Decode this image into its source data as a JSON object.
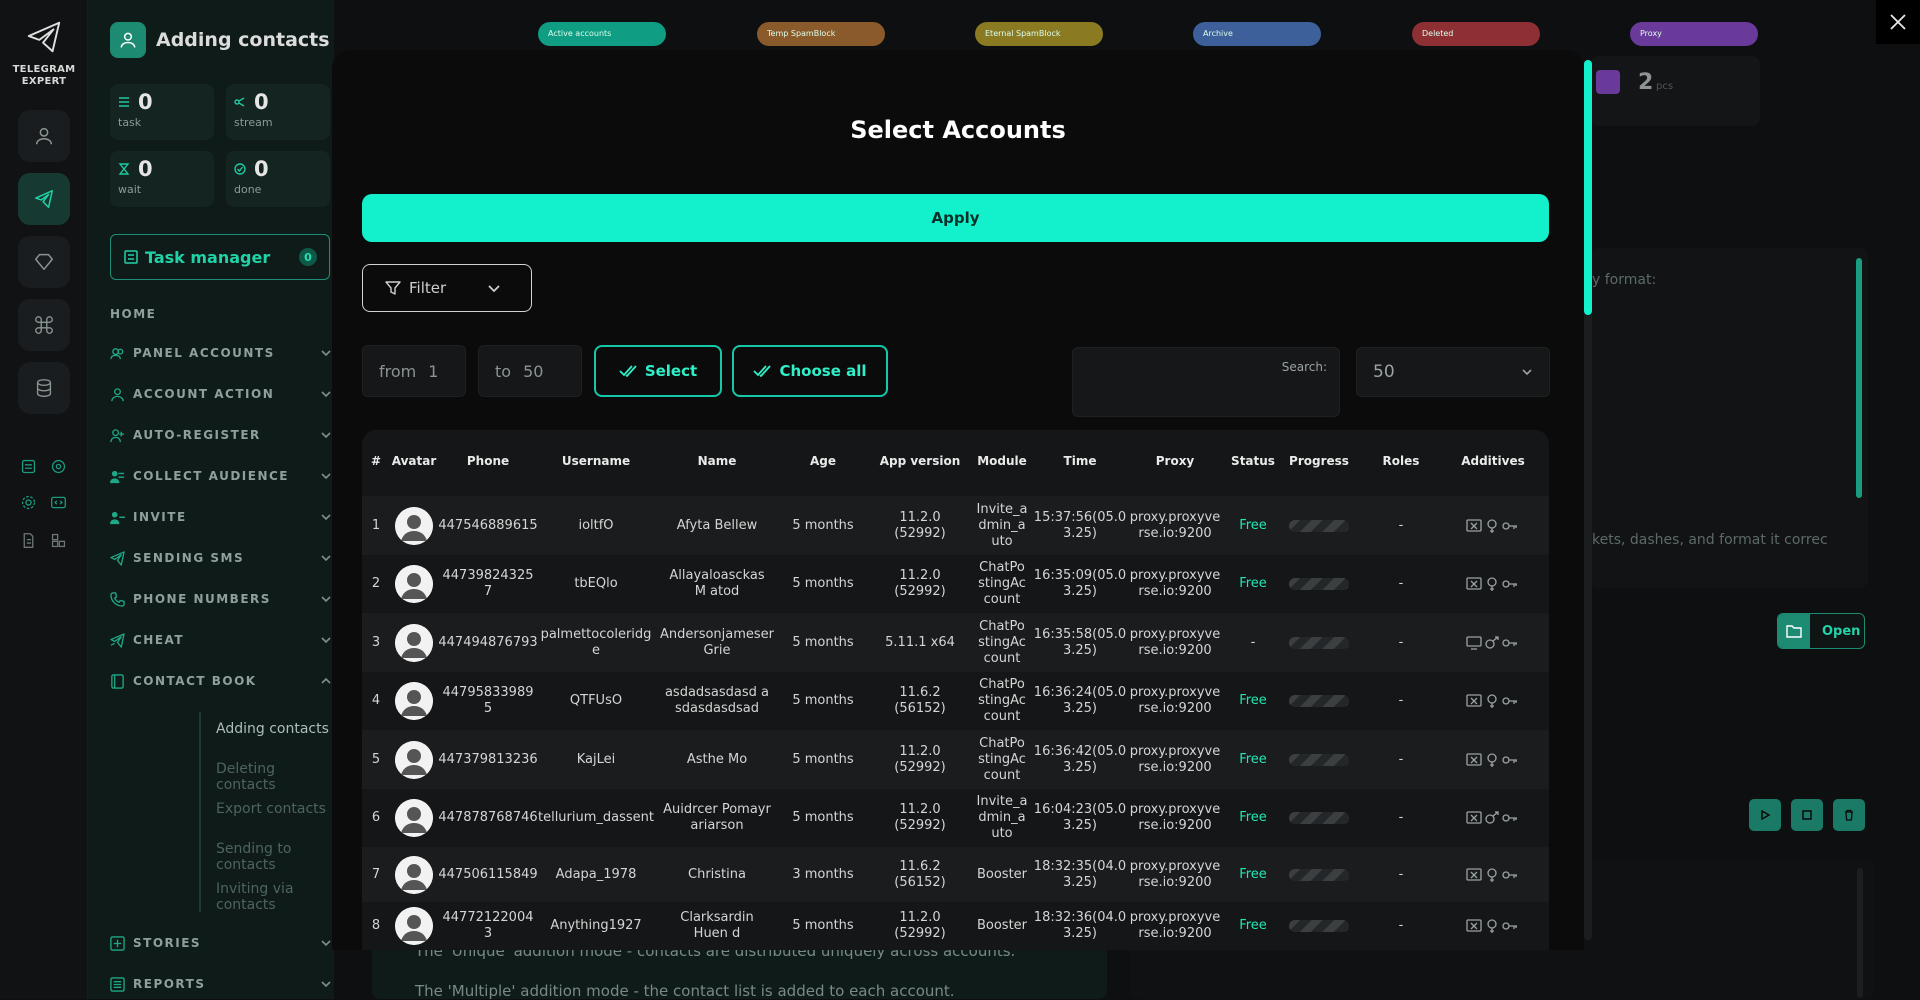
{
  "app": {
    "logo_line1": "TELEGRAM",
    "logo_line2": "EXPERT"
  },
  "sidebar": {
    "title": "Adding contacts",
    "stats": [
      {
        "value": "0",
        "label": "task"
      },
      {
        "value": "0",
        "label": "stream"
      },
      {
        "value": "0",
        "label": "wait"
      },
      {
        "value": "0",
        "label": "done"
      }
    ],
    "task_manager": {
      "label": "Task manager",
      "count": "0"
    },
    "home": "HOME",
    "nav": [
      {
        "label": "PANEL ACCOUNTS"
      },
      {
        "label": "ACCOUNT ACTION"
      },
      {
        "label": "AUTO-REGISTER"
      },
      {
        "label": "COLLECT AUDIENCE"
      },
      {
        "label": "INVITE"
      },
      {
        "label": "SENDING SMS"
      },
      {
        "label": "PHONE NUMBERS"
      },
      {
        "label": "CHEAT"
      },
      {
        "label": "CONTACT BOOK"
      },
      {
        "label": "STORIES"
      },
      {
        "label": "REPORTS"
      }
    ],
    "contact_book_sub": [
      "Adding contacts",
      "Deleting contacts",
      "Export contacts",
      "Sending to contacts",
      "Inviting via contacts"
    ]
  },
  "top_pills": [
    {
      "label": "Active accounts",
      "color": "#0f9d83"
    },
    {
      "label": "Temp SpamBlock",
      "color": "#8a5a2a"
    },
    {
      "label": "Eternal SpamBlock",
      "color": "#8a7a22"
    },
    {
      "label": "Archive",
      "color": "#3d5f9a"
    },
    {
      "label": "Deleted",
      "color": "#8e2f34"
    },
    {
      "label": "Proxy",
      "color": "#6a3a9a"
    }
  ],
  "background": {
    "proxy_count": "2",
    "proxy_unit": "pcs",
    "format_hint": "y format:",
    "format_hint2": "kets, dashes, and format it correc",
    "open_label": "Open",
    "mode_unique": "The 'Unique' addition mode - contacts are distributed uniquely across accounts.",
    "mode_multiple": "The 'Multiple' addition mode - the contact list is added to each account."
  },
  "modal": {
    "title": "Select Accounts",
    "apply": "Apply",
    "filter": "Filter",
    "from_label": "from",
    "from_value": "1",
    "to_label": "to",
    "to_value": "50",
    "select": "Select",
    "choose_all": "Choose all",
    "search_label": "Search:",
    "per_page": "50",
    "columns": [
      "#",
      "Avatar",
      "Phone",
      "Username",
      "Name",
      "Age",
      "App version",
      "Module",
      "Time",
      "Proxy",
      "Status",
      "Progress",
      "Roles",
      "Additives"
    ],
    "rows": [
      {
        "n": "1",
        "phone": "447546889615",
        "username": "ioltfO",
        "name": "Afyta Bellew",
        "age": "5 months",
        "app": "11.2.0 (52992)",
        "module": "Invite_a dmin_a uto",
        "time": "15:37:56(05.0 3.25)",
        "proxy": "proxy.proxyve rse.io:9200",
        "status": "Free",
        "roles": "-"
      },
      {
        "n": "2",
        "phone": "44739824325 7",
        "username": "tbEQlo",
        "name": "Allayaloasckas M atod",
        "age": "5 months",
        "app": "11.2.0 (52992)",
        "module": "ChatPo stingAc count",
        "time": "16:35:09(05.0 3.25)",
        "proxy": "proxy.proxyve rse.io:9200",
        "status": "Free",
        "roles": "-"
      },
      {
        "n": "3",
        "phone": "447494876793",
        "username": "palmettocoleridg e",
        "name": "Andersonjameser Grie",
        "age": "5 months",
        "app": "5.11.1 x64",
        "module": "ChatPo stingAc count",
        "time": "16:35:58(05.0 3.25)",
        "proxy": "proxy.proxyve rse.io:9200",
        "status": "-",
        "roles": "-"
      },
      {
        "n": "4",
        "phone": "44795833989 5",
        "username": "QTFUsO",
        "name": "asdadsasdasd a sdasdasdsad",
        "age": "5 months",
        "app": "11.6.2 (56152)",
        "module": "ChatPo stingAc count",
        "time": "16:36:24(05.0 3.25)",
        "proxy": "proxy.proxyve rse.io:9200",
        "status": "Free",
        "roles": "-"
      },
      {
        "n": "5",
        "phone": "447379813236",
        "username": "KajLei",
        "name": "Asthe Mo",
        "age": "5 months",
        "app": "11.2.0 (52992)",
        "module": "ChatPo stingAc count",
        "time": "16:36:42(05.0 3.25)",
        "proxy": "proxy.proxyve rse.io:9200",
        "status": "Free",
        "roles": "-"
      },
      {
        "n": "6",
        "phone": "447878768746",
        "username": "tellurium_dassent",
        "name": "Auidrcer Pomayr ariarson",
        "age": "5 months",
        "app": "11.2.0 (52992)",
        "module": "Invite_a dmin_a uto",
        "time": "16:04:23(05.0 3.25)",
        "proxy": "proxy.proxyve rse.io:9200",
        "status": "Free",
        "roles": "-"
      },
      {
        "n": "7",
        "phone": "447506115849",
        "username": "Adapa_1978",
        "name": "Christina",
        "age": "3 months",
        "app": "11.6.2 (56152)",
        "module": "Booster",
        "time": "18:32:35(04.0 3.25)",
        "proxy": "proxy.proxyve rse.io:9200",
        "status": "Free",
        "roles": "-"
      },
      {
        "n": "8",
        "phone": "44772122004 3",
        "username": "Anything1927",
        "name": "Clarksardin Huen d",
        "age": "5 months",
        "app": "11.2.0 (52992)",
        "module": "Booster",
        "time": "18:32:36(04.0 3.25)",
        "proxy": "proxy.proxyve rse.io:9200",
        "status": "Free",
        "roles": "-"
      }
    ]
  }
}
